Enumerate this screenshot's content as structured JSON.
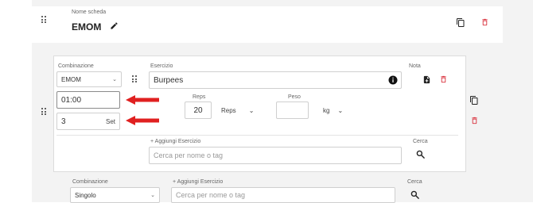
{
  "header": {
    "name_label": "Nome scheda",
    "title": "EMOM"
  },
  "block": {
    "combination_label": "Combinazione",
    "combination_value": "EMOM",
    "exercise_label": "Esercizio",
    "exercise_value": "Burpees",
    "note_label": "Nota",
    "time_value": "01:00",
    "sets_value": "3",
    "sets_unit": "Set",
    "reps_label": "Reps",
    "reps_value": "20",
    "reps_unit": "Reps",
    "weight_label": "Peso",
    "weight_value": "",
    "weight_unit": "kg",
    "add_exercise_label": "+ Aggiungi Esercizio",
    "search_placeholder": "Cerca per nome o tag",
    "search_label": "Cerca"
  },
  "block2": {
    "combination_label": "Combinazione",
    "combination_value": "Singolo",
    "add_exercise_label": "+ Aggiungi Esercizio",
    "search_placeholder": "Cerca per nome o tag",
    "search_label": "Cerca"
  },
  "colors": {
    "delete": "#d9323e",
    "arrow": "#e02020"
  }
}
